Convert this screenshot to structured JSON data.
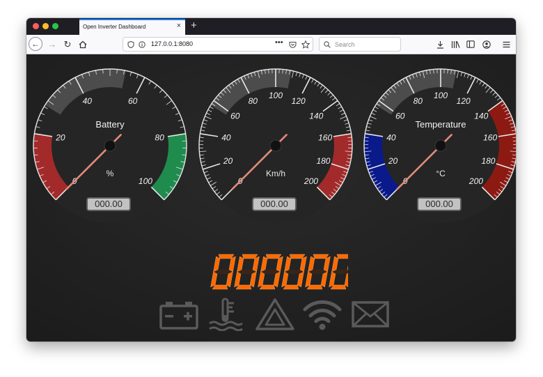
{
  "browser": {
    "tab_title": "Open Inverter Dashboard",
    "tab_close": "×",
    "new_tab": "+",
    "url": "127.0.0.1:8080",
    "search_placeholder": "Search"
  },
  "gauges": [
    {
      "title": "Battery",
      "unit": "%",
      "readout": "000.00",
      "min": 0,
      "max": 100,
      "value": 0,
      "labels": [
        "0",
        "20",
        "40",
        "60",
        "80",
        "100"
      ],
      "bands": [
        {
          "from": 0,
          "to": 20,
          "color": "#a32a2a"
        },
        {
          "from": 80,
          "to": 100,
          "color": "#1f8c4e"
        }
      ]
    },
    {
      "title": "",
      "unit": "Km/h",
      "readout": "000.00",
      "min": 0,
      "max": 200,
      "value": 0,
      "labels": [
        "0",
        "20",
        "40",
        "60",
        "80",
        "100",
        "120",
        "140",
        "160",
        "180",
        "200"
      ],
      "bands": [
        {
          "from": 160,
          "to": 200,
          "color": "#a32a2a"
        }
      ]
    },
    {
      "title": "Temperature",
      "unit": "°C",
      "readout": "000.00",
      "min": 0,
      "max": 200,
      "value": 0,
      "labels": [
        "0",
        "20",
        "40",
        "60",
        "80",
        "100",
        "120",
        "140",
        "160",
        "180",
        "200"
      ],
      "bands": [
        {
          "from": 0,
          "to": 40,
          "color": "#0a1a8a"
        },
        {
          "from": 140,
          "to": 200,
          "color": "#8c1a12"
        }
      ]
    }
  ],
  "odometer": {
    "value": "000000",
    "color": "#ff6a00"
  },
  "indicators": [
    {
      "name": "battery-warning-icon",
      "state": "off"
    },
    {
      "name": "coolant-temperature-icon",
      "state": "off"
    },
    {
      "name": "hazard-warning-icon",
      "state": "off"
    },
    {
      "name": "wifi-icon",
      "state": "off"
    },
    {
      "name": "message-icon",
      "state": "off"
    }
  ]
}
